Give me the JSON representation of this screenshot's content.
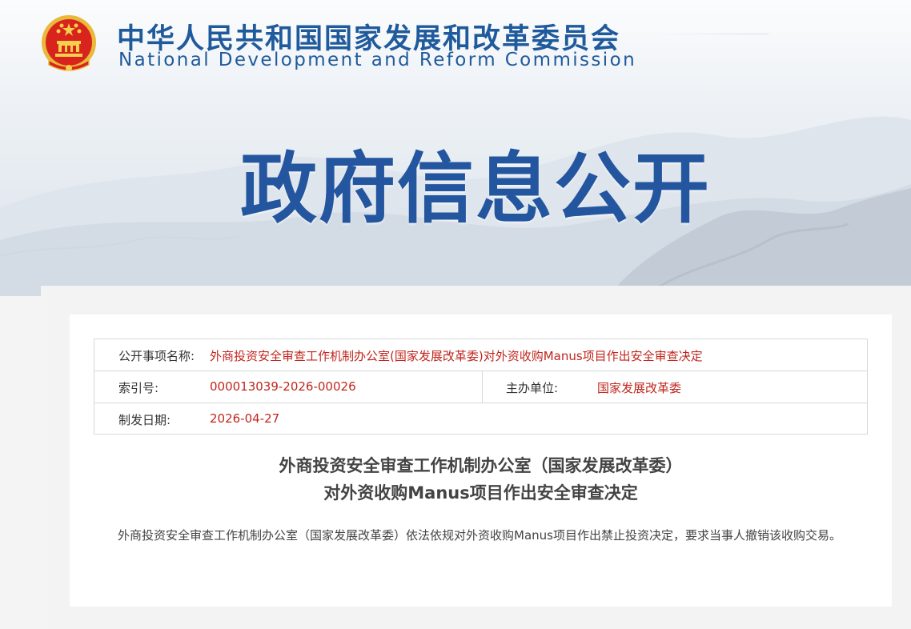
{
  "header": {
    "org_name_cn": "中华人民共和国国家发展和改革委员会",
    "org_name_en": "National Development and Reform Commission",
    "emblem_icon": "national-emblem-icon"
  },
  "banner": {
    "title": "政府信息公开"
  },
  "info_table": {
    "item_name_label": "公开事项名称:",
    "item_name_value": "外商投资安全审查工作机制办公室(国家发展改革委)对外资收购Manus项目作出安全审查决定",
    "index_label": "索引号:",
    "index_value": "000013039-2026-00026",
    "dept_label": "主办单位:",
    "dept_value": "国家发展改革委",
    "date_label": "制发日期:",
    "date_value": "2026-04-27"
  },
  "document": {
    "title_line1": "外商投资安全审查工作机制办公室（国家发展改革委）",
    "title_line2": "对外资收购Manus项目作出安全审查决定",
    "body": "外商投资安全审查工作机制办公室（国家发展改革委）依法依规对外资收购Manus项目作出禁止投资决定，要求当事人撤销该收购交易。"
  },
  "colors": {
    "brand_blue": "#1f5a9c",
    "banner_blue": "#2456a0",
    "value_red": "#c0261d"
  }
}
